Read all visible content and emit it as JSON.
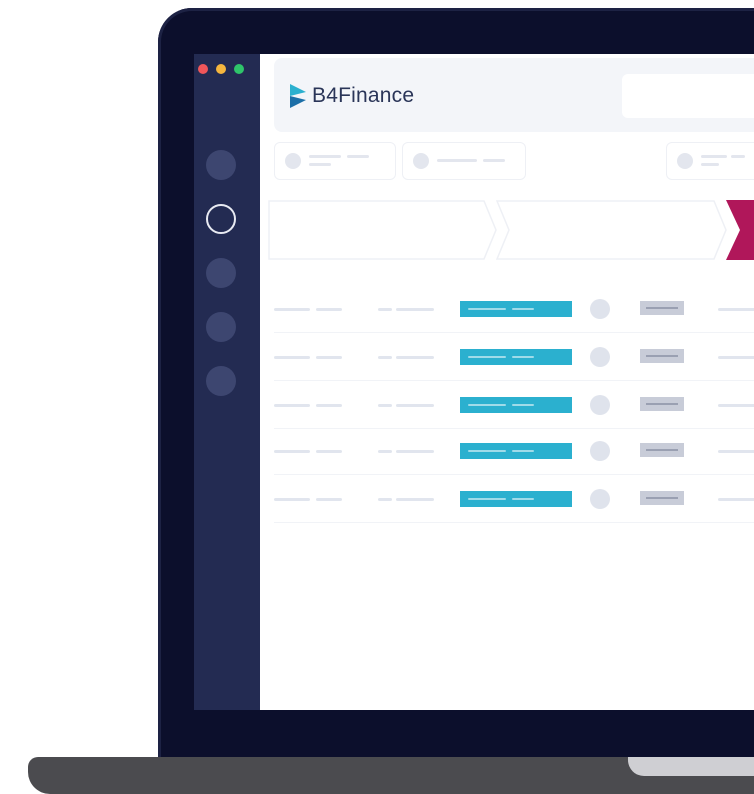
{
  "app": {
    "brand_name": "B4Finance",
    "brand_color": "#2bb0cf",
    "brand_text_color": "#2a3558"
  },
  "window_controls": [
    {
      "name": "close",
      "color": "#f0565a"
    },
    {
      "name": "minimize",
      "color": "#f5b63e"
    },
    {
      "name": "maximize",
      "color": "#2fc56a"
    }
  ],
  "sidebar": {
    "background": "#232b52",
    "items": [
      {
        "icon": "circle-icon",
        "active": false
      },
      {
        "icon": "circle-outline-icon",
        "active": true
      },
      {
        "icon": "circle-icon",
        "active": false
      },
      {
        "icon": "circle-icon",
        "active": false
      },
      {
        "icon": "circle-icon",
        "active": false
      }
    ]
  },
  "process_steps": [
    {
      "state": "inactive",
      "color": "#ffffff"
    },
    {
      "state": "inactive",
      "color": "#ffffff"
    },
    {
      "state": "active",
      "color": "#b0175a"
    }
  ],
  "table": {
    "row_count": 5,
    "status_color": "#2bb0cf",
    "tag_color": "#c8ccd8"
  }
}
